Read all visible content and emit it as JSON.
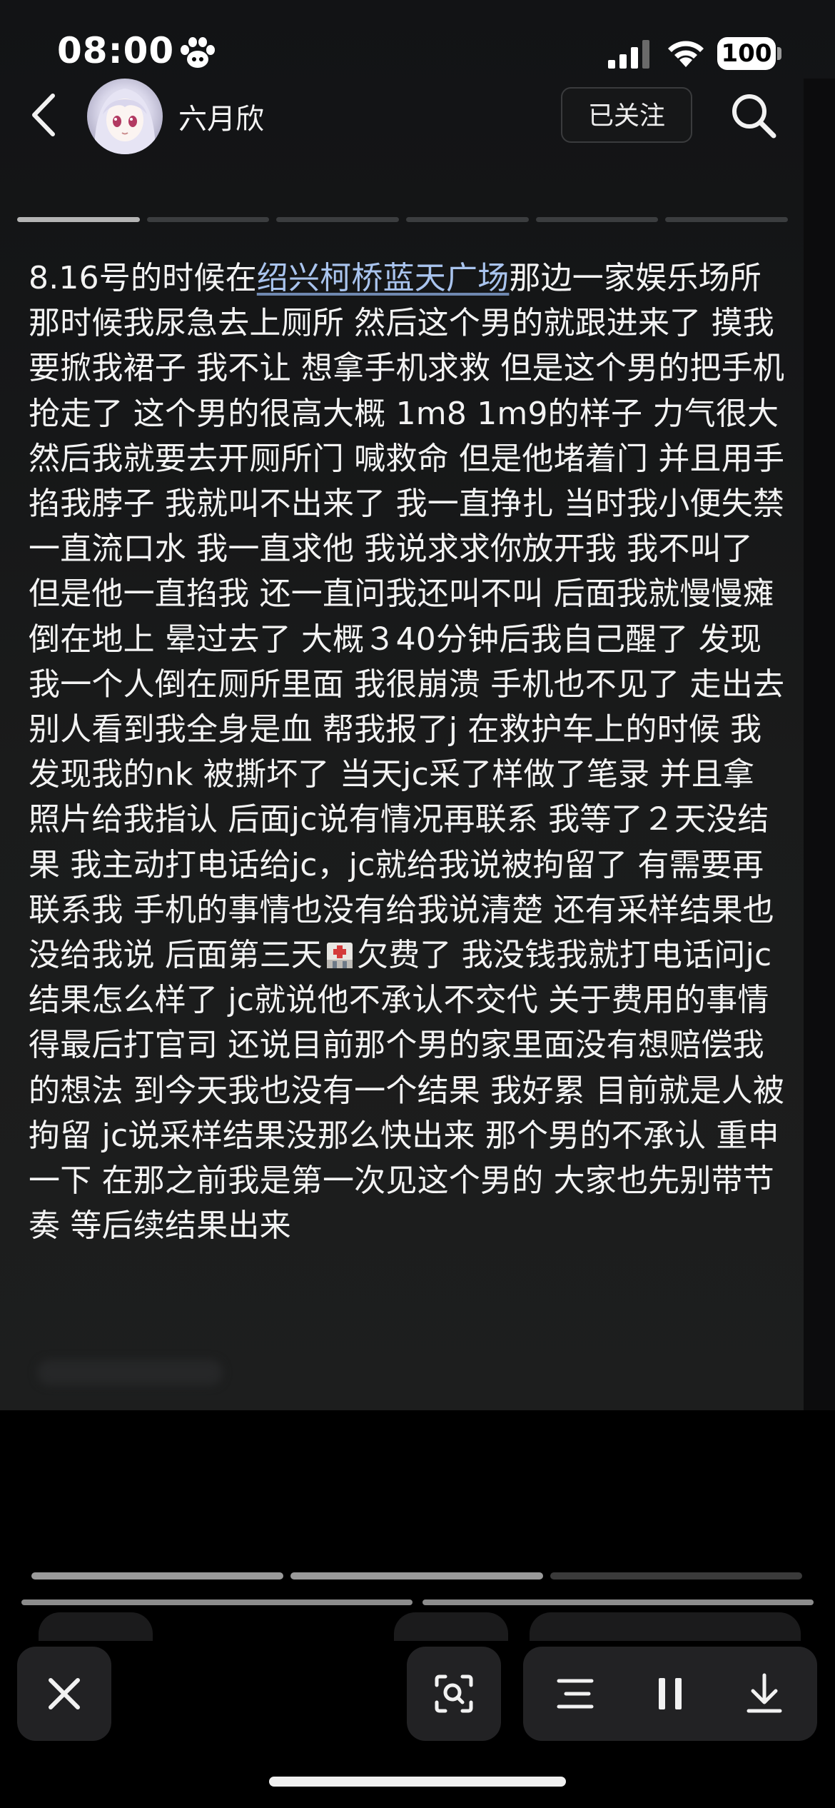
{
  "status_bar": {
    "time": "08:00",
    "battery": "100"
  },
  "header": {
    "username": "六月欣",
    "follow_label": "已关注"
  },
  "post": {
    "prefix": "8.16号的时候在",
    "location_link": "绍兴柯桥蓝天广场",
    "part1": "那边一家娱乐场所那时候我尿急去上厕所 然后这个男的就跟进来了 摸我 要掀我裙子 我不让 想拿手机求救 但是这个男的把手机抢走了 这个男的很高大概 1m8 1m9的样子 力气很大 然后我就要去开厕所门 喊救命 但是他堵着门 并且用手掐我脖子 我就叫不出来了 我一直挣扎 当时我小便失禁 一直流口水 我一直求他 我说求求你放开我 我不叫了 但是他一直掐我 还一直问我还叫不叫 后面我就慢慢瘫倒在地上 晕过去了 大概３40分钟后我自己醒了 发现我一个人倒在厕所里面 我很崩溃 手机也不见了 走出去别人看到我全身是血 帮我报了j 在救护车上的时候 我发现我的nk 被撕坏了 当天jc采了样做了笔录 并且拿照片给我指认 后面jc说有情况再联系 我等了２天没结果 我主动打电话给jc，jc就给我说被拘留了 有需要再联系我 手机的事情也没有给我说清楚 还有采样结果也没给我说 后面第三天",
    "part2": "欠费了 我没钱我就打电话问jc结果怎么样了 jc就说他不承认不交代 关于费用的事情得最后打官司 还说目前那个男的家里面没有想赔偿我的想法 到今天我也没有一个结果 我好累 目前就是人被拘留 jc说采样结果没那么快出来 那个男的不承认 重申一下 在那之前我是第一次见这个男的 大家也先别带节奏 等后续结果出来"
  },
  "icons": {
    "back": "chevron-left-icon",
    "search": "search-icon",
    "hospital": "hospital-icon",
    "close": "close-icon",
    "scan": "scan-text-icon",
    "list": "list-icon",
    "pause": "pause-icon",
    "download": "download-icon"
  },
  "colors": {
    "background": "#000000",
    "panel": "#1a1b1b",
    "link": "#a9c4ee",
    "button": "#222224"
  }
}
